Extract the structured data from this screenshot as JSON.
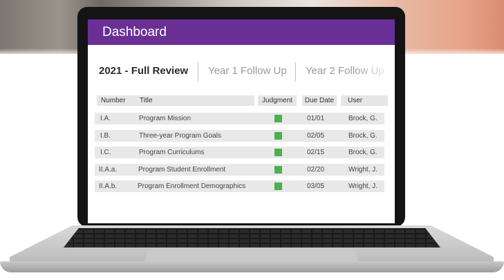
{
  "header": {
    "title": "Dashboard"
  },
  "tabs": [
    {
      "label": "2021 - Full Review"
    },
    {
      "label": "Year 1 Follow Up"
    },
    {
      "label": "Year 2 Follow Up"
    }
  ],
  "table": {
    "columns": [
      "Number",
      "Title",
      "Judgment",
      "Due Date",
      "User"
    ],
    "rows": [
      {
        "number": "I.A.",
        "title": "Program Mission",
        "due": "01/01",
        "user": "Brock, G."
      },
      {
        "number": "I.B.",
        "title": "Three-year Program Goals",
        "due": "02/05",
        "user": "Brock, G."
      },
      {
        "number": "I.C.",
        "title": "Program Curriculums",
        "due": "02/15",
        "user": "Brock, G."
      },
      {
        "number": "II.A.a.",
        "title": "Program Student Enrollment",
        "due": "02/20",
        "user": "Wright, J."
      },
      {
        "number": "II.A.b.",
        "title": "Program Enrollment Demographics",
        "due": "03/05",
        "user": "Wright, J."
      }
    ],
    "judgment_color": "#4caf50"
  },
  "colors": {
    "header": "#6a2f95"
  }
}
